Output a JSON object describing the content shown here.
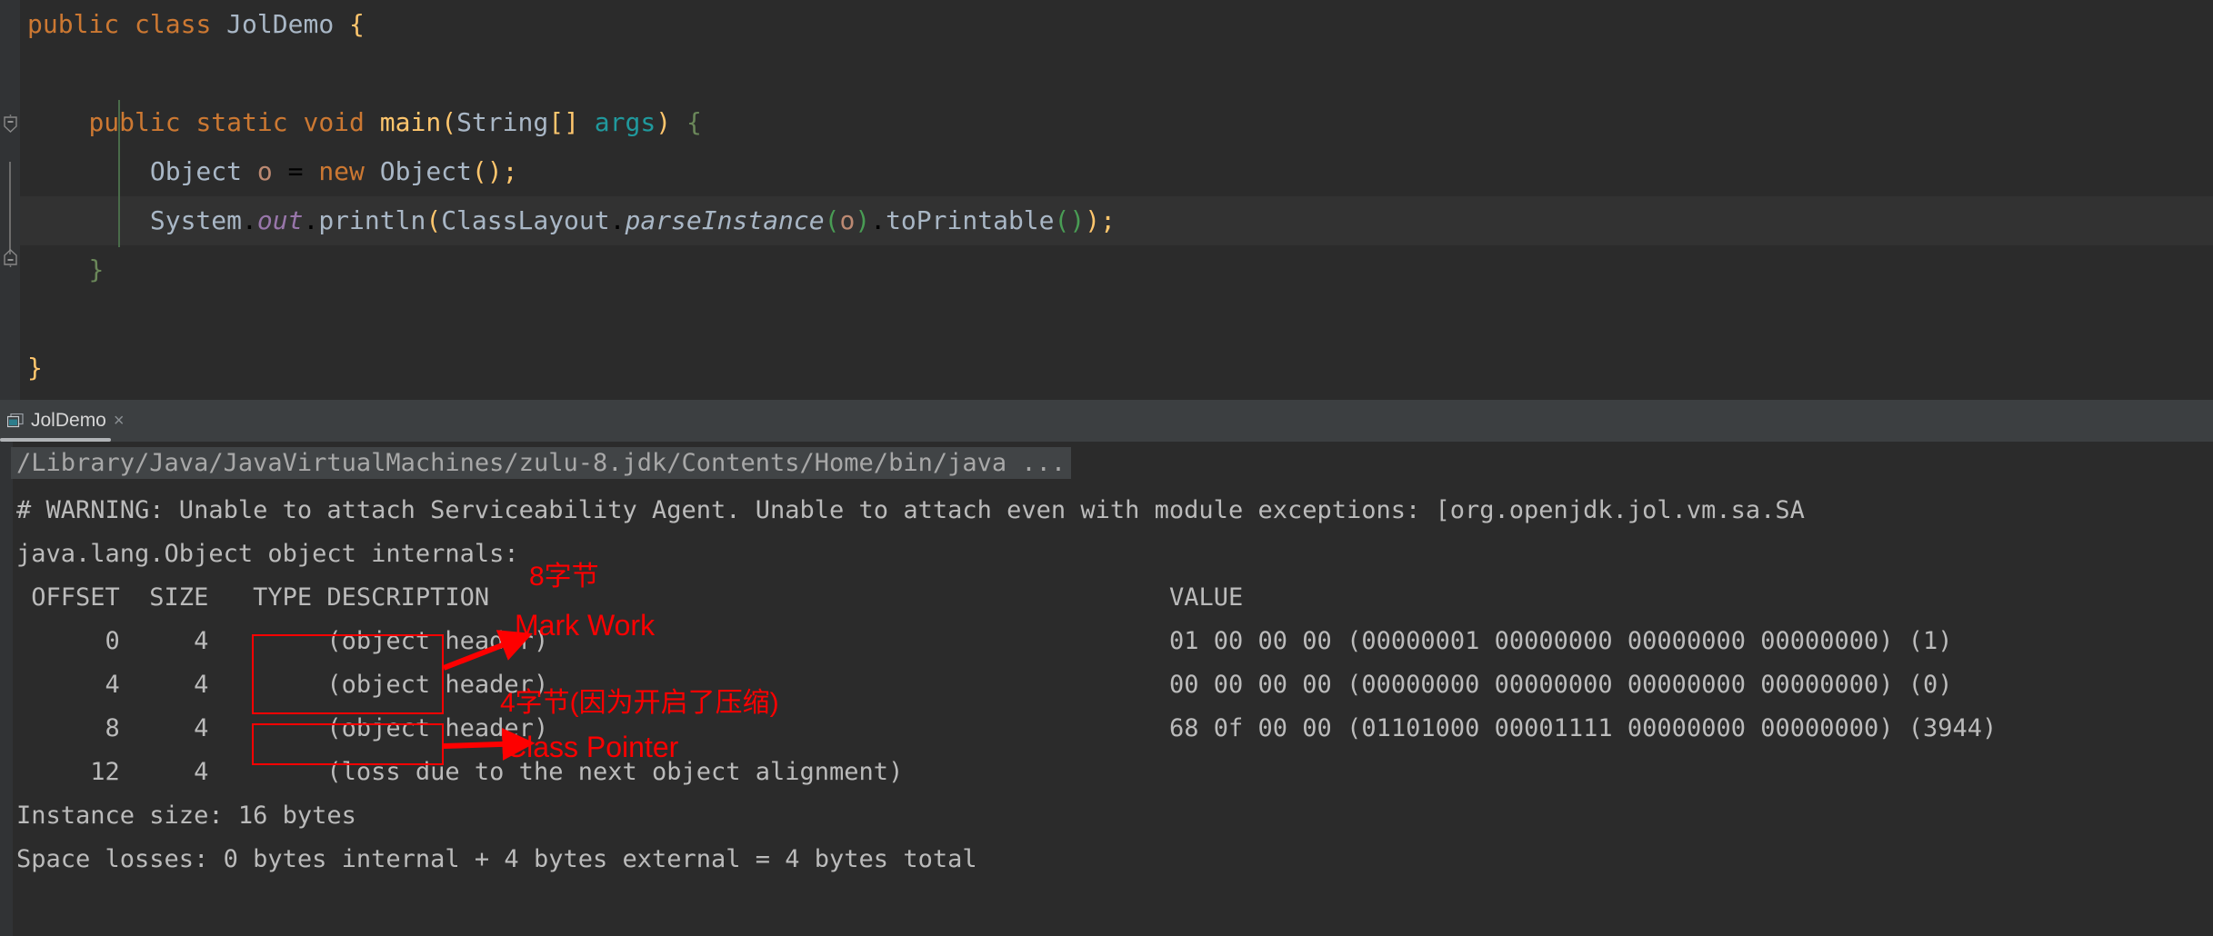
{
  "editor": {
    "lines": [
      "public class JolDemo {",
      "",
      "    public static void main(String[] args) {",
      "        Object o = new Object();",
      "        System.out.println(ClassLayout.parseInstance(o).toPrintable());",
      "    }",
      "",
      "}"
    ],
    "fold_icon_top": "fold-minus-icon",
    "fold_icon_bottom": "fold-minus-icon"
  },
  "console_tab": {
    "icon": "console-window-icon",
    "label": "JolDemo",
    "close": "×"
  },
  "console": {
    "command_line": "/Library/Java/JavaVirtualMachines/zulu-8.jdk/Contents/Home/bin/java ...",
    "warning": "# WARNING: Unable to attach Serviceability Agent. Unable to attach even with module exceptions: [org.openjdk.jol.vm.sa.SA",
    "title": "java.lang.Object object internals:",
    "header": " OFFSET  SIZE   TYPE DESCRIPTION",
    "value_header": "VALUE",
    "rows": [
      {
        "left": "      0     4        (object header)",
        "value": "01 00 00 00 (00000001 00000000 00000000 00000000) (1)"
      },
      {
        "left": "      4     4        (object header)",
        "value": "00 00 00 00 (00000000 00000000 00000000 00000000) (0)"
      },
      {
        "left": "      8     4        (object header)",
        "value": "68 0f 00 00 (01101000 00001111 00000000 00000000) (3944)"
      },
      {
        "left": "     12     4        (loss due to the next object alignment)",
        "value": ""
      }
    ],
    "instance_size": "Instance size: 16 bytes",
    "space_losses": "Space losses: 0 bytes internal + 4 bytes external = 4 bytes total"
  },
  "annotations": {
    "color": "#fe0000",
    "mark_word_bytes": "8字节",
    "mark_word_label": "Mark Work",
    "class_pointer_bytes": "4字节(因为开启了压缩)",
    "class_pointer_label": "Class Pointer"
  }
}
